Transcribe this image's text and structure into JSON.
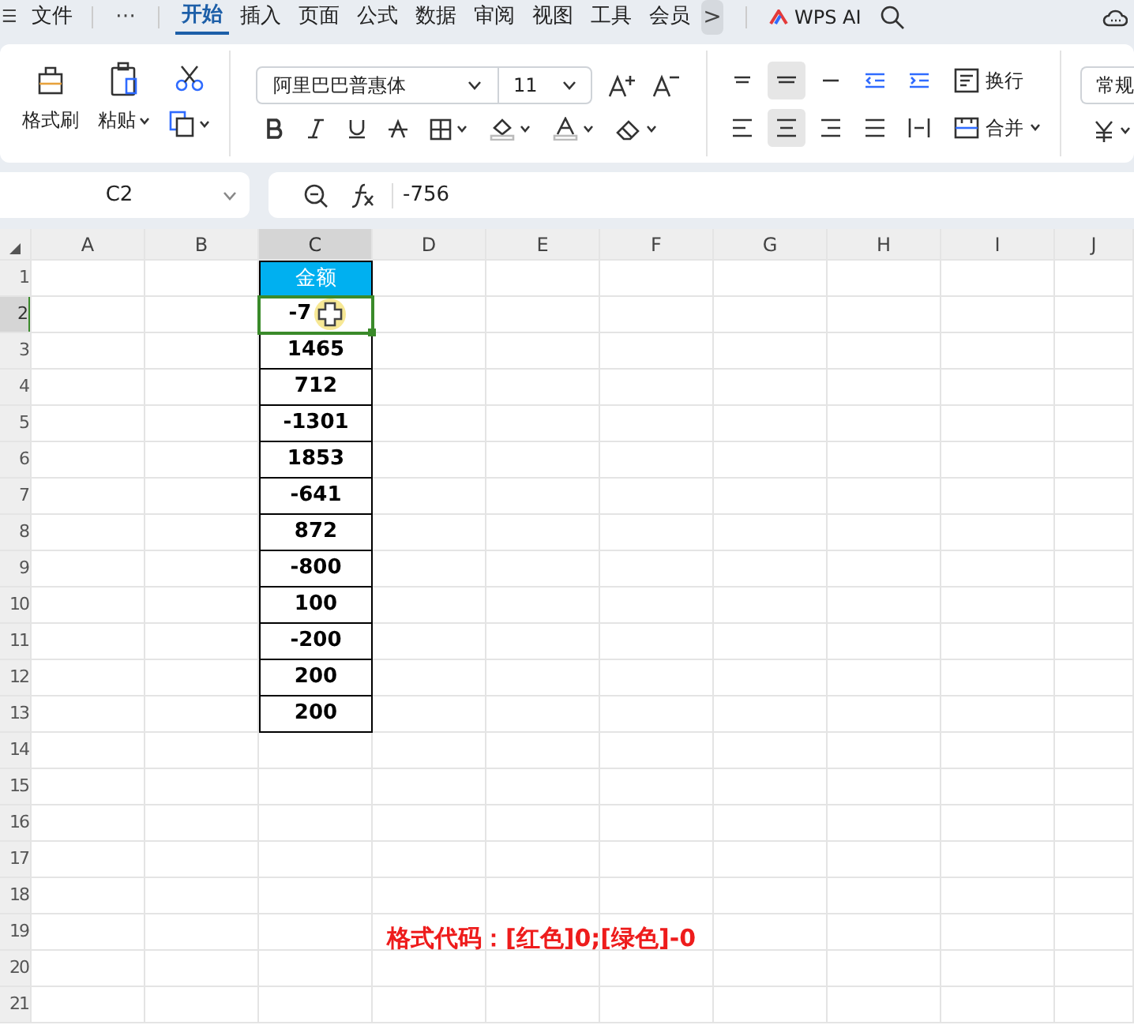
{
  "menu_bar": {
    "menu_icon": "☰",
    "file": "文件",
    "more": "⋯",
    "tabs": [
      {
        "label": "开始",
        "selected": true
      },
      {
        "label": "插入",
        "selected": false
      },
      {
        "label": "页面",
        "selected": false
      },
      {
        "label": "公式",
        "selected": false
      },
      {
        "label": "数据",
        "selected": false
      },
      {
        "label": "审阅",
        "selected": false
      },
      {
        "label": "视图",
        "selected": false
      },
      {
        "label": "工具",
        "selected": false
      },
      {
        "label": "会员",
        "selected": false
      }
    ],
    "scroll_button": ">",
    "ai_button": "WPS AI"
  },
  "ribbon": {
    "format_painter": "格式刷",
    "paste": "粘贴",
    "font_name": "阿里巴巴普惠体",
    "font_size": "11",
    "wrap": "换行",
    "merge": "合并",
    "number_format": "常规"
  },
  "formula_bar": {
    "name_box": "C2",
    "formula": "-756"
  },
  "sheet": {
    "columns": [
      {
        "label": "A",
        "selected": false
      },
      {
        "label": "B",
        "selected": false
      },
      {
        "label": "C",
        "selected": true
      },
      {
        "label": "D",
        "selected": false
      },
      {
        "label": "E",
        "selected": false
      },
      {
        "label": "F",
        "selected": false
      },
      {
        "label": "G",
        "selected": false
      },
      {
        "label": "H",
        "selected": false
      },
      {
        "label": "I",
        "selected": false
      },
      {
        "label": "J",
        "selected": false
      }
    ],
    "rows": [
      {
        "label": "1",
        "selected": false
      },
      {
        "label": "2",
        "selected": true
      },
      {
        "label": "3",
        "selected": false
      },
      {
        "label": "4",
        "selected": false
      },
      {
        "label": "5",
        "selected": false
      },
      {
        "label": "6",
        "selected": false
      },
      {
        "label": "7",
        "selected": false
      },
      {
        "label": "8",
        "selected": false
      },
      {
        "label": "9",
        "selected": false
      },
      {
        "label": "10",
        "selected": false
      },
      {
        "label": "11",
        "selected": false
      },
      {
        "label": "12",
        "selected": false
      },
      {
        "label": "13",
        "selected": false
      },
      {
        "label": "14",
        "selected": false
      },
      {
        "label": "15",
        "selected": false
      },
      {
        "label": "16",
        "selected": false
      },
      {
        "label": "17",
        "selected": false
      },
      {
        "label": "18",
        "selected": false
      },
      {
        "label": "19",
        "selected": false
      },
      {
        "label": "20",
        "selected": false
      },
      {
        "label": "21",
        "selected": false
      }
    ],
    "column_c": [
      {
        "text": "金额",
        "kind": "header",
        "selected": false
      },
      {
        "text": "-7",
        "kind": "value",
        "selected": true
      },
      {
        "text": "1465",
        "kind": "value",
        "selected": false
      },
      {
        "text": "712",
        "kind": "value",
        "selected": false
      },
      {
        "text": "-1301",
        "kind": "value",
        "selected": false
      },
      {
        "text": "1853",
        "kind": "value",
        "selected": false
      },
      {
        "text": "-641",
        "kind": "value",
        "selected": false
      },
      {
        "text": "872",
        "kind": "value",
        "selected": false
      },
      {
        "text": "-800",
        "kind": "value",
        "selected": false
      },
      {
        "text": "100",
        "kind": "value",
        "selected": false
      },
      {
        "text": "-200",
        "kind": "value",
        "selected": false
      },
      {
        "text": "200",
        "kind": "value",
        "selected": false
      },
      {
        "text": "200",
        "kind": "value",
        "selected": false
      }
    ]
  },
  "caption": "格式代码：[红色]0;[绿色]-0"
}
